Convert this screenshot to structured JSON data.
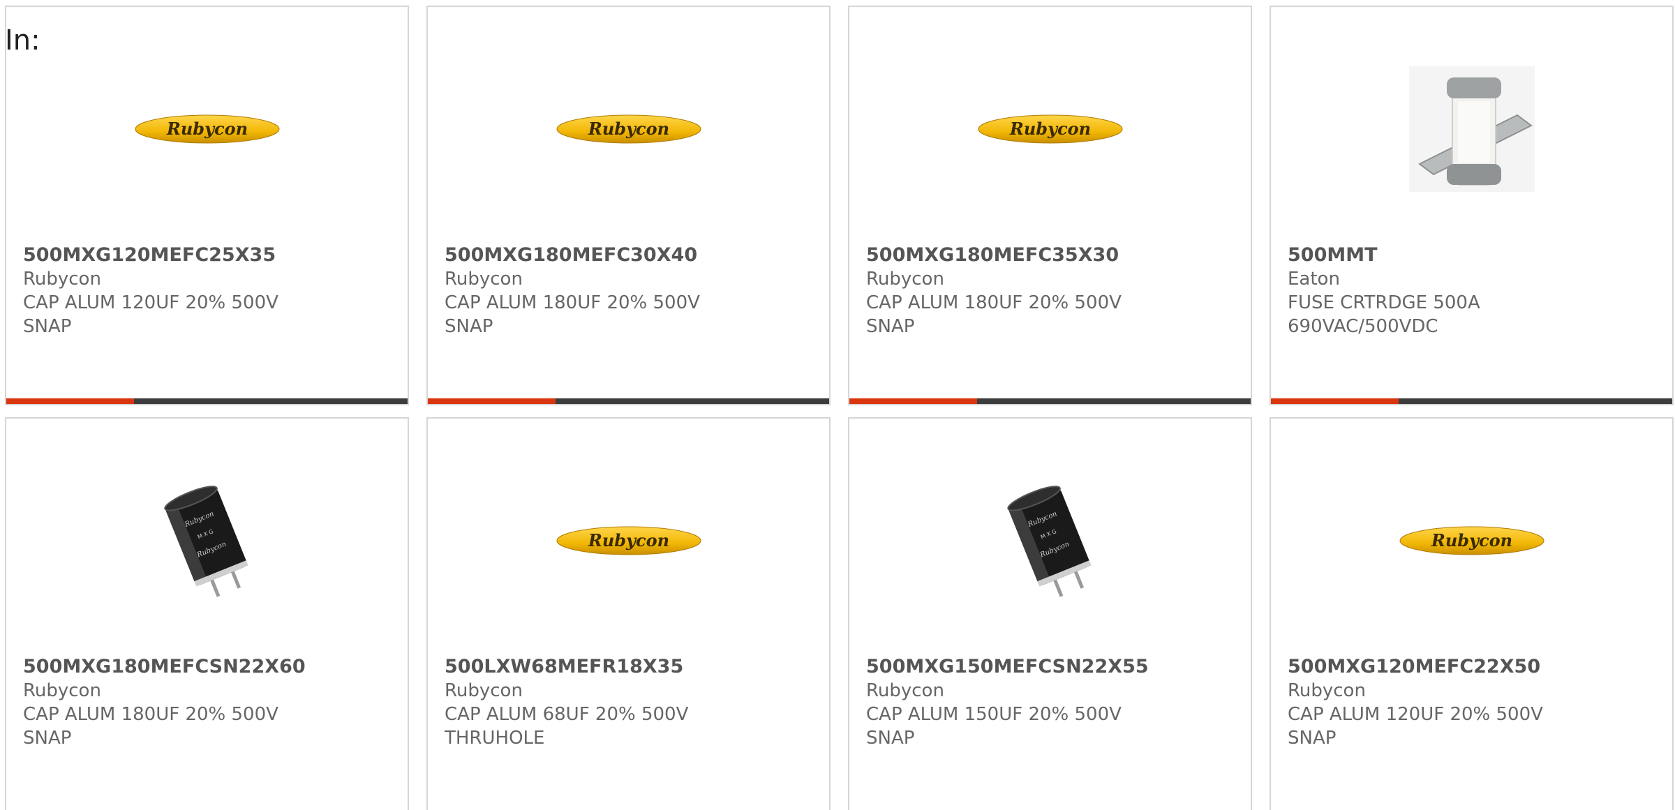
{
  "header": {
    "prefix_label": "In:"
  },
  "cards": [
    {
      "part": "500MXG120MEFC25X35",
      "mfr": "Rubycon",
      "desc": "CAP ALUM 120UF 20% 500V",
      "desc2": "SNAP",
      "image": "rubycon-logo"
    },
    {
      "part": "500MXG180MEFC30X40",
      "mfr": "Rubycon",
      "desc": "CAP ALUM 180UF 20% 500V",
      "desc2": "SNAP",
      "image": "rubycon-logo"
    },
    {
      "part": "500MXG180MEFC35X30",
      "mfr": "Rubycon",
      "desc": "CAP ALUM 180UF 20% 500V",
      "desc2": "SNAP",
      "image": "rubycon-logo"
    },
    {
      "part": "500MMT",
      "mfr": "Eaton",
      "desc": "FUSE CRTRDGE 500A",
      "desc2": "690VAC/500VDC",
      "image": "fuse-photo"
    },
    {
      "part": "500MXG180MEFCSN22X60",
      "mfr": "Rubycon",
      "desc": "CAP ALUM 180UF 20% 500V",
      "desc2": "SNAP",
      "image": "capacitor-photo"
    },
    {
      "part": "500LXW68MEFR18X35",
      "mfr": "Rubycon",
      "desc": "CAP ALUM 68UF 20% 500V",
      "desc2": "THRUHOLE",
      "image": "rubycon-logo"
    },
    {
      "part": "500MXG150MEFCSN22X55",
      "mfr": "Rubycon",
      "desc": "CAP ALUM 150UF 20% 500V",
      "desc2": "SNAP",
      "image": "capacitor-photo"
    },
    {
      "part": "500MXG120MEFC22X50",
      "mfr": "Rubycon",
      "desc": "CAP ALUM 120UF 20% 500V",
      "desc2": "SNAP",
      "image": "rubycon-logo"
    }
  ],
  "logo_text": "Rubycon",
  "colors": {
    "accent_red": "#d9360f",
    "accent_dark": "#3d3d3d",
    "logo_yellow": "#f2b705",
    "logo_text": "#3a2a00"
  }
}
